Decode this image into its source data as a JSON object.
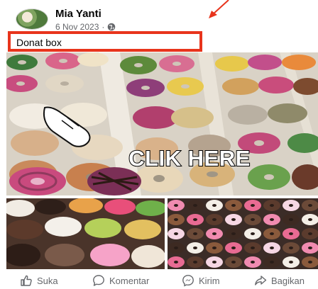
{
  "post": {
    "author": "Mia Yanti",
    "date": "6 Nov 2023",
    "separator": "·",
    "caption": "Donat box",
    "overlay_text": "CLIK HERE"
  },
  "actions": {
    "like_label": "Suka",
    "comment_label": "Komentar",
    "send_label": "Kirim",
    "share_label": "Bagikan"
  },
  "icons": {
    "audience": "globe-icon",
    "annotation": "red-arrow-icon",
    "pointer": "hand-pointer-icon",
    "like": "thumbs-up-icon",
    "comment": "comment-bubble-icon",
    "send": "messenger-icon",
    "share": "share-arrow-icon"
  },
  "colors": {
    "highlight_border": "#e8341c",
    "meta_text": "#65676b",
    "action_text": "#65676b"
  }
}
